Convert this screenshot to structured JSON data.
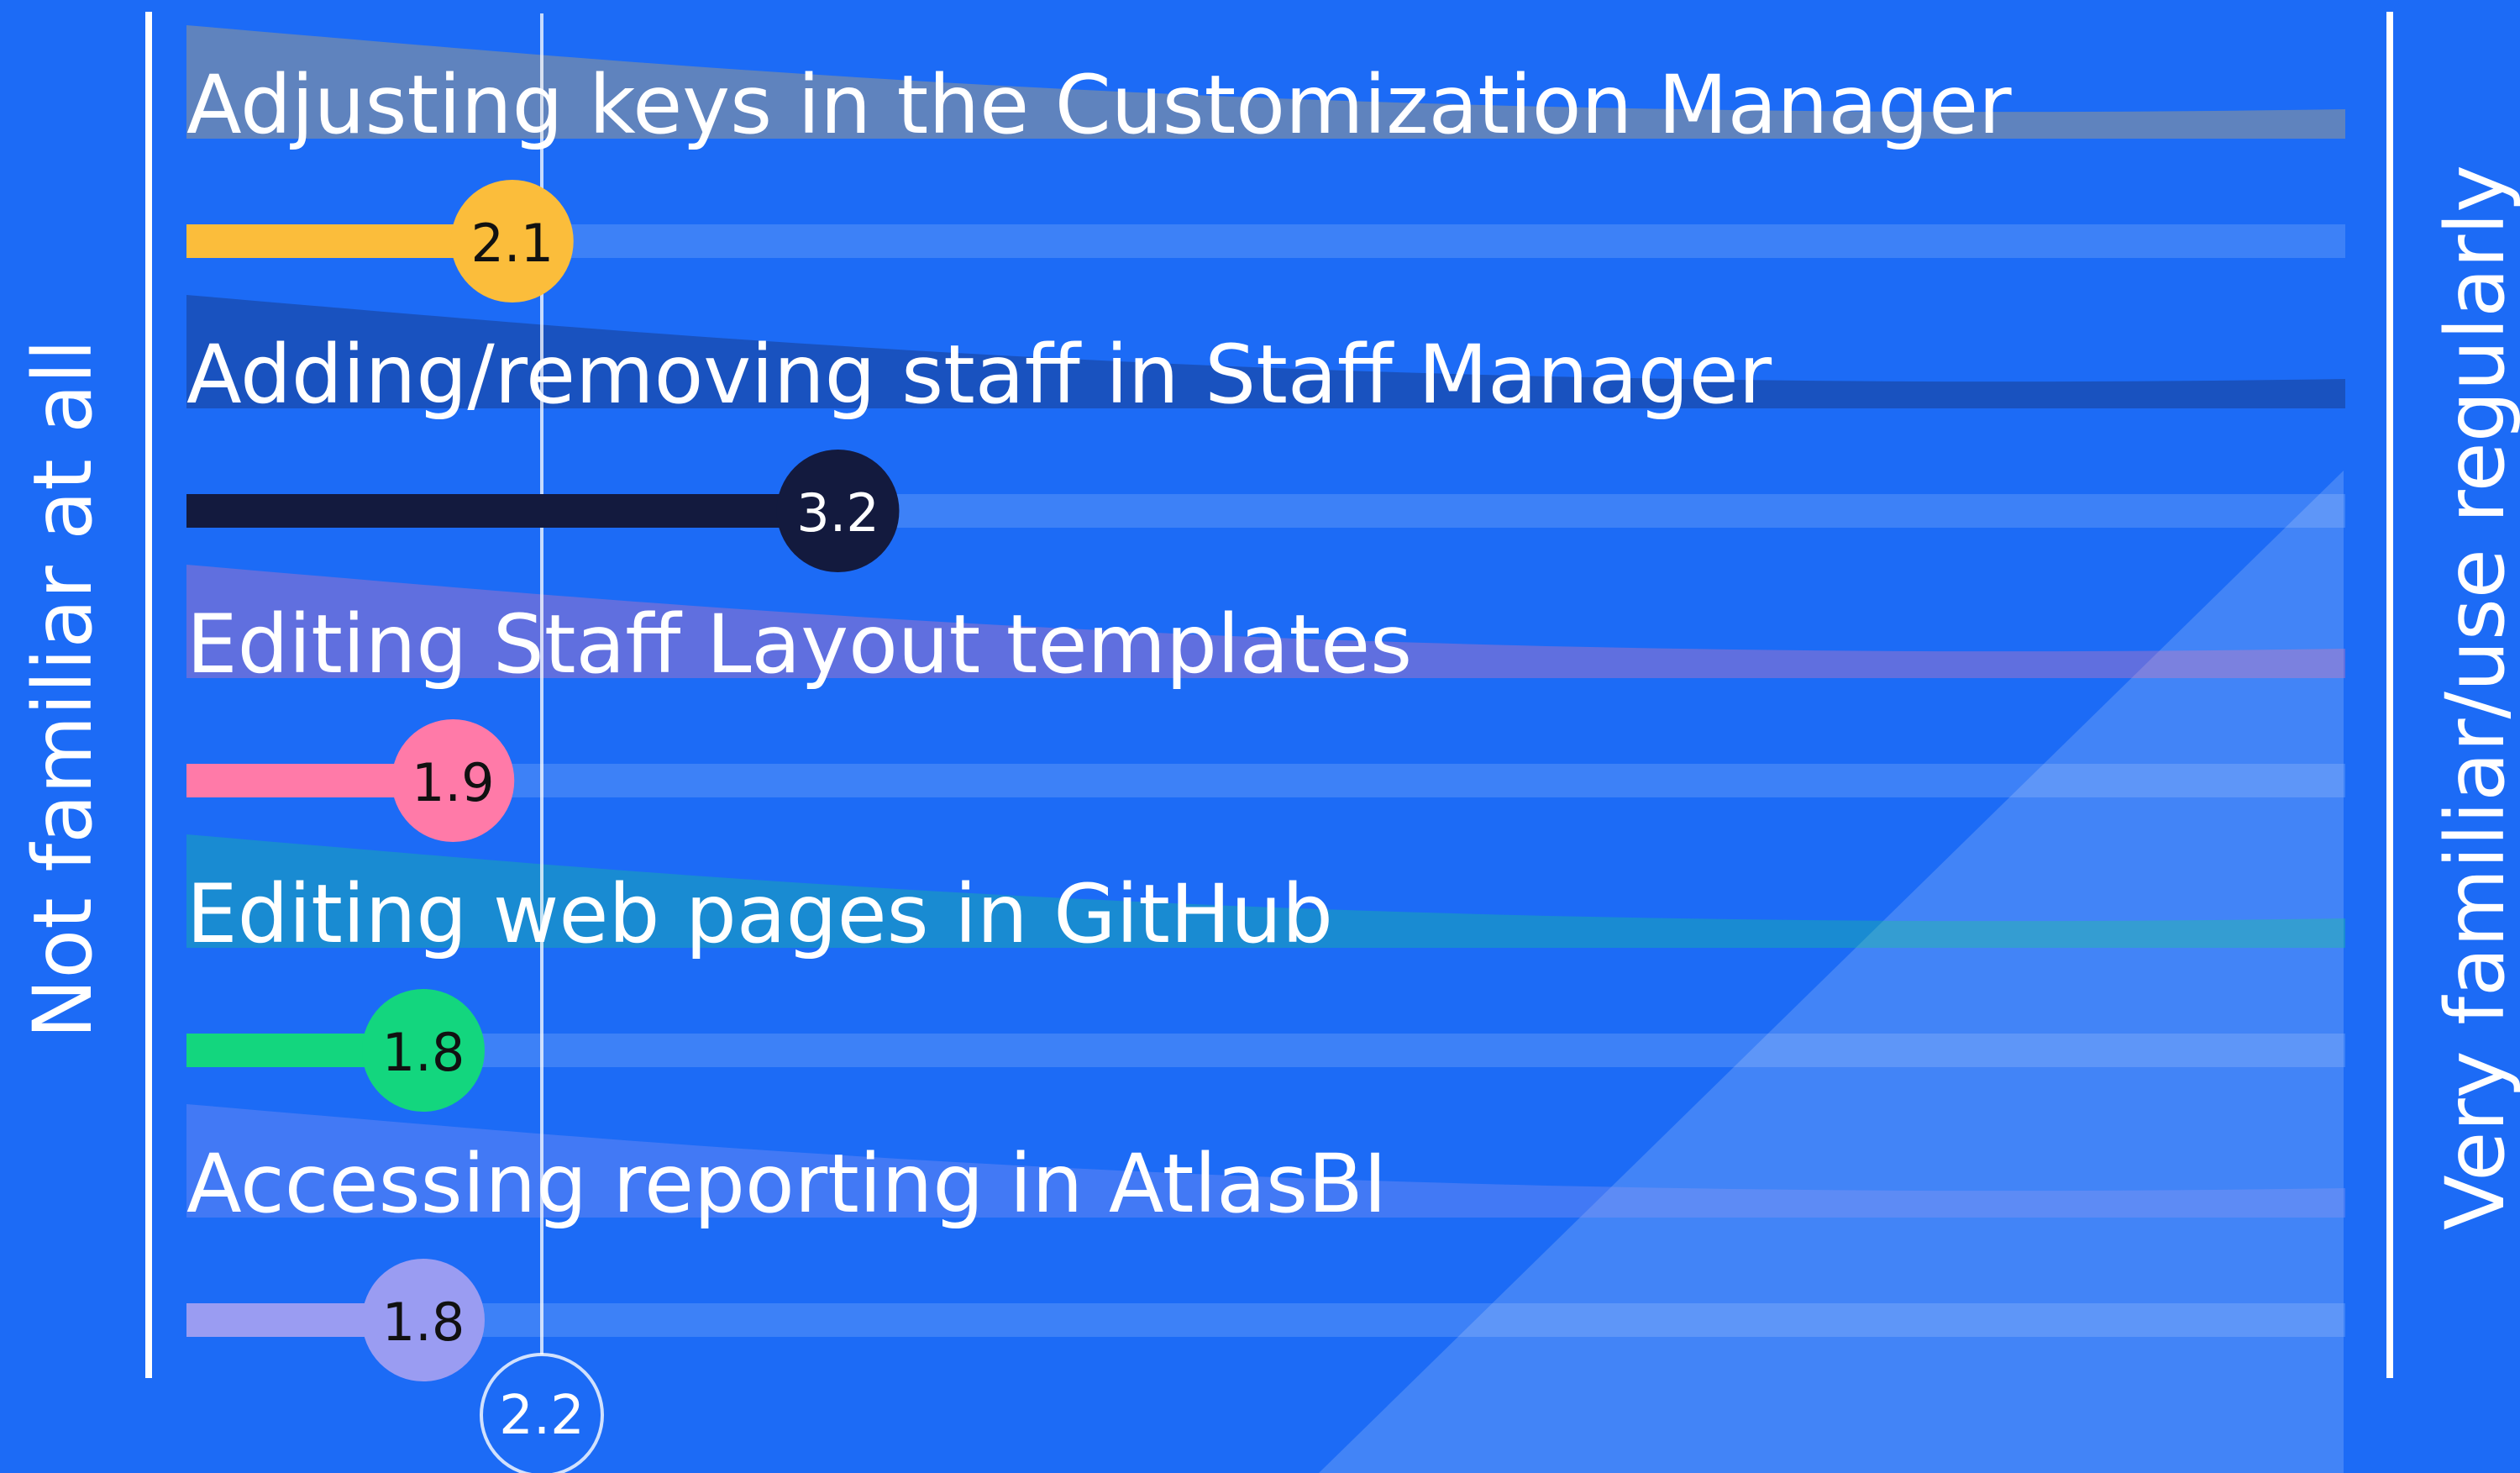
{
  "chart_data": {
    "type": "bar",
    "orientation": "horizontal",
    "x_min_label": "Not familiar at all",
    "x_max_label": "Very familiar/use regularly",
    "xlim": [
      1,
      5
    ],
    "reference_line": {
      "value": 2.2,
      "label": "2.2"
    },
    "categories": [
      "Adjusting keys in the Customization Manager",
      "Adding/removing staff in Staff Manager",
      "Editing Staff Layout templates",
      "Editing web pages in GitHub",
      "Accessing reporting in AtlasBI"
    ],
    "values": [
      2.1,
      3.2,
      1.9,
      1.8,
      1.8
    ],
    "value_labels": [
      "2.1",
      "3.2",
      "1.9",
      "1.8",
      "1.8"
    ],
    "colors": [
      "#fbbd3b",
      "#131a3e",
      "#ff7aa8",
      "#13d67e",
      "#9a9cf2"
    ],
    "label_colors": [
      "#111111",
      "#ffffff",
      "#111111",
      "#111111",
      "#111111"
    ],
    "background": "#1c6bf6"
  }
}
